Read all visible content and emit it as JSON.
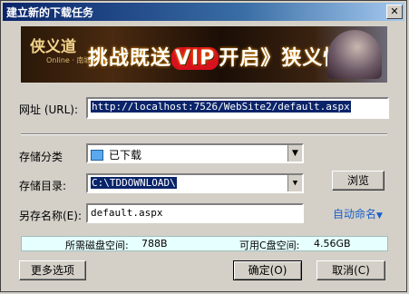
{
  "window": {
    "title": "建立新的下载任务",
    "close_glyph": "✕"
  },
  "banner": {
    "logo_text": "侠义道",
    "logo_subtext": "Online · 南城早园",
    "headline_pre": "挑战既送",
    "headline_vip": "VIP",
    "headline_post": "开启》狭义情仇"
  },
  "url": {
    "label": "网址 (URL):",
    "value": "http://localhost:7526/WebSite2/default.aspx"
  },
  "category": {
    "label": "存储分类",
    "value": "已下载"
  },
  "directory": {
    "label": "存储目录:",
    "value": "C:\\TDDOWNLOAD\\",
    "browse_label": "浏览"
  },
  "filename": {
    "label": "另存名称(E):",
    "value": "default.aspx",
    "auto_name_label": "自动命名"
  },
  "disk": {
    "required_label": "所需磁盘空间:",
    "required_value": "788B",
    "available_label": "可用C盘空间:",
    "available_value": "4.56GB"
  },
  "buttons": {
    "more_options": "更多选项",
    "ok": "确定(O)",
    "cancel": "取消(C)"
  },
  "icons": {
    "dropdown": "▼"
  },
  "colors": {
    "titlebar_start": "#0a246a",
    "selection": "#0a246a",
    "link": "#1a5fc7",
    "info_bg": "#e6ffff"
  }
}
